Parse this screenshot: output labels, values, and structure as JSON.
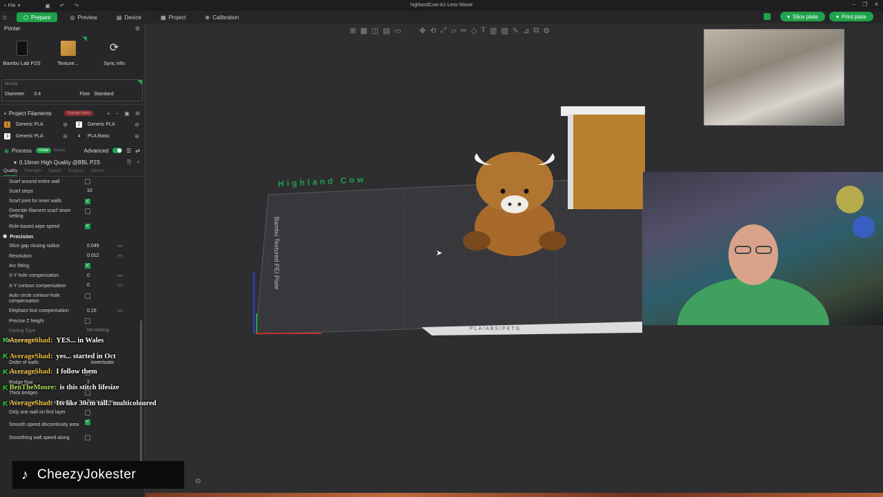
{
  "titlebar": {
    "file_label": "File",
    "title": "highlandCow-A1-Less-Waste"
  },
  "nav": {
    "tabs": [
      {
        "label": "Prepare",
        "icon": "prepare-icon"
      },
      {
        "label": "Preview",
        "icon": "preview-icon"
      },
      {
        "label": "Device",
        "icon": "device-icon"
      },
      {
        "label": "Project",
        "icon": "project-icon"
      },
      {
        "label": "Calibration",
        "icon": "calibration-icon"
      }
    ],
    "slice_label": "Slice plate",
    "print_label": "Print plate"
  },
  "printer": {
    "section_title": "Printer",
    "printer_name": "Bambu Lab P2S",
    "plate_label": "Texture...",
    "sync_label": "Sync info",
    "nozzle_title": "Nozzle",
    "diameter_label": "Diameter",
    "diameter_value": "0.4",
    "flow_label": "Flow",
    "flow_value": "Standard"
  },
  "filaments": {
    "title": "Project Filaments",
    "badge": "Syncing colors",
    "items": [
      {
        "num": "1",
        "name": "Generic PLA",
        "color": "#d08a2a"
      },
      {
        "num": "2",
        "name": "Generic PLA",
        "color": "#ffffff"
      },
      {
        "num": "3",
        "name": "Generic PLA",
        "color": "#ffffff"
      },
      {
        "num": "4",
        "name": "PLA Basic",
        "color": "#222222"
      }
    ]
  },
  "process": {
    "title": "Process",
    "global_label": "Global",
    "objects_label": "Objects",
    "advanced_label": "Advanced",
    "preset": "0.16mm High Quality @BBL P2S",
    "tabs": [
      "Quality",
      "Strength",
      "Speed",
      "Support",
      "Others"
    ],
    "rows_top": [
      {
        "label": "Scarf around entire wall",
        "type": "check",
        "on": false
      },
      {
        "label": "Scarf steps",
        "type": "value",
        "value": "10"
      },
      {
        "label": "Scarf joint for inner walls",
        "type": "check",
        "on": true
      },
      {
        "label": "Override filament scarf seam setting",
        "type": "check",
        "on": false,
        "two": true
      },
      {
        "label": "Role-based wipe speed",
        "type": "check",
        "on": true
      }
    ],
    "precision_title": "Precision",
    "rows_precision": [
      {
        "label": "Slice gap closing radius",
        "type": "value",
        "value": "0.049",
        "unit": "mm"
      },
      {
        "label": "Resolution",
        "type": "value",
        "value": "0.012",
        "unit": "mm"
      },
      {
        "label": "Arc fitting",
        "type": "check",
        "on": true
      },
      {
        "label": "X-Y hole compensation",
        "type": "value",
        "value": "0",
        "unit": "mm"
      },
      {
        "label": "X-Y contour compensation",
        "type": "value",
        "value": "0",
        "unit": "mm"
      },
      {
        "label": "Auto circle contour-hole compensation",
        "type": "check",
        "on": false,
        "two": true
      },
      {
        "label": "Elephant foot compensation",
        "type": "value",
        "value": "0.15",
        "unit": "mm"
      },
      {
        "label": "Precise Z height",
        "type": "check",
        "on": false
      }
    ],
    "ironing_label": "Ironing Type",
    "ironing_value": "No ironing",
    "wall_gen_title": "Wall generator",
    "order_label": "Order of walls",
    "order_value": "inner/outer",
    "rows_bottom": [
      {
        "label": "Print infill first",
        "type": "check",
        "on": false
      },
      {
        "label": "Bridge flow",
        "type": "value",
        "value": "1"
      },
      {
        "label": "Thick bridges",
        "type": "check",
        "on": false
      },
      {
        "label": "Only one wall on top surfaces",
        "type": "value",
        "value": "Top surfaces"
      },
      {
        "label": "Only one wall on first layer",
        "type": "check",
        "on": false
      },
      {
        "label": "Smooth speed discontinuity area",
        "type": "check",
        "on": true,
        "two": true
      },
      {
        "label": "Smoothing wall speed along",
        "type": "check",
        "on": false
      }
    ]
  },
  "viewport": {
    "bed_title": "Highland Cow",
    "bed_label": "Bambu Textured PEI Plate",
    "bed_front_label": "PLA/ABS/PETG"
  },
  "chat": [
    {
      "user": "AverageShad:",
      "user_color": "#f0c040",
      "msg": "YES... in Wales"
    },
    {
      "user": "AverageShad:",
      "user_color": "#f0c040",
      "msg": "yes... started in Oct"
    },
    {
      "user": "AverageShad:",
      "user_color": "#f0c040",
      "msg": "I follow them"
    },
    {
      "user": "BenTheMoore:",
      "user_color": "#b0e05a",
      "msg": "is this stitch lifesize"
    },
    {
      "user": "AverageShad:",
      "user_color": "#f0c040",
      "msg": "Its like 30cm tall.. multicoloured"
    }
  ],
  "tiktok": {
    "handle": "CheezyJokester"
  }
}
